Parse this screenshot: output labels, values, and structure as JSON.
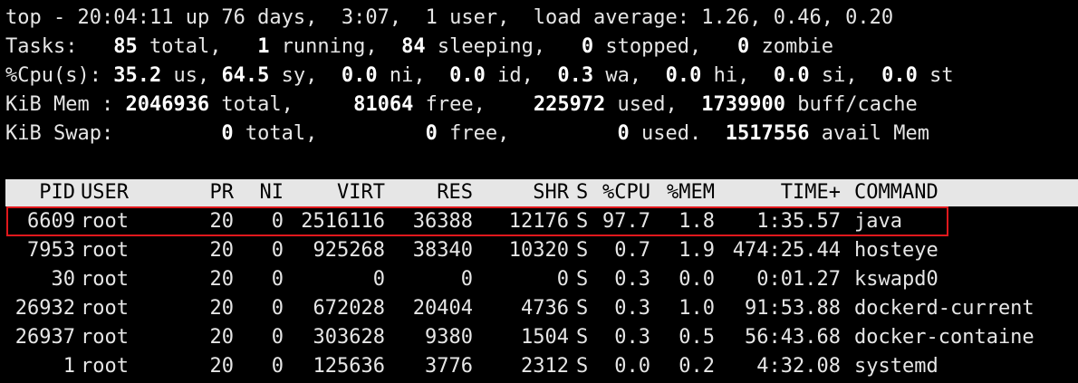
{
  "summary": {
    "uptime": {
      "prefix": "top - ",
      "time": "20:04:11",
      "rest": " up 76 days,  3:07,  1 user,  load average: 1.26, 0.46, 0.20"
    },
    "tasks": {
      "label": "Tasks: ",
      "total": "85",
      "total_l": " total, ",
      "running": "1",
      "running_l": " running, ",
      "sleeping": "84",
      "sleeping_l": " sleeping, ",
      "stopped": "0",
      "stopped_l": " stopped, ",
      "zombie": "0",
      "zombie_l": " zombie"
    },
    "cpu": {
      "label": "%Cpu(s): ",
      "us": "35.2",
      "us_l": " us, ",
      "sy": "64.5",
      "sy_l": " sy, ",
      "ni": "0.0",
      "ni_l": " ni, ",
      "id": "0.0",
      "id_l": " id, ",
      "wa": "0.3",
      "wa_l": " wa, ",
      "hi": "0.0",
      "hi_l": " hi, ",
      "si": "0.0",
      "si_l": " si, ",
      "st": "0.0",
      "st_l": " st"
    },
    "mem": {
      "label": "KiB Mem : ",
      "total": "2046936",
      "total_l": " total, ",
      "free": "81064",
      "free_l": " free, ",
      "used": "225972",
      "used_l": " used, ",
      "buff": "1739900",
      "buff_l": " buff/cache"
    },
    "swap": {
      "label": "KiB Swap: ",
      "total": "0",
      "total_l": " total, ",
      "free": "0",
      "free_l": " free, ",
      "used": "0",
      "used_l": " used. ",
      "avail": "1517556",
      "avail_l": " avail Mem"
    }
  },
  "columns": [
    "PID",
    "USER",
    "PR",
    "NI",
    "VIRT",
    "RES",
    "SHR",
    "S",
    "%CPU",
    "%MEM",
    "TIME+",
    "COMMAND"
  ],
  "processes": [
    [
      "6609",
      "root",
      "20",
      "0",
      "2516116",
      "36388",
      "12176",
      "S",
      "97.7",
      "1.8",
      "1:35.57",
      "java"
    ],
    [
      "7953",
      "root",
      "20",
      "0",
      "925268",
      "38340",
      "10320",
      "S",
      "0.7",
      "1.9",
      "474:25.44",
      "hosteye"
    ],
    [
      "30",
      "root",
      "20",
      "0",
      "0",
      "0",
      "0",
      "S",
      "0.3",
      "0.0",
      "0:01.27",
      "kswapd0"
    ],
    [
      "26932",
      "root",
      "20",
      "0",
      "672028",
      "20404",
      "4736",
      "S",
      "0.3",
      "1.0",
      "91:53.88",
      "dockerd-current"
    ],
    [
      "26937",
      "root",
      "20",
      "0",
      "303628",
      "9380",
      "1504",
      "S",
      "0.3",
      "0.5",
      "56:43.68",
      "docker-containe"
    ],
    [
      "1",
      "root",
      "20",
      "0",
      "125636",
      "3776",
      "2312",
      "S",
      "0.0",
      "0.2",
      "4:32.08",
      "systemd"
    ]
  ],
  "colors": {
    "background": "#000000",
    "text": "#e6e6e6",
    "header_bg": "#e6e6e6",
    "highlight": "#e0181c"
  }
}
